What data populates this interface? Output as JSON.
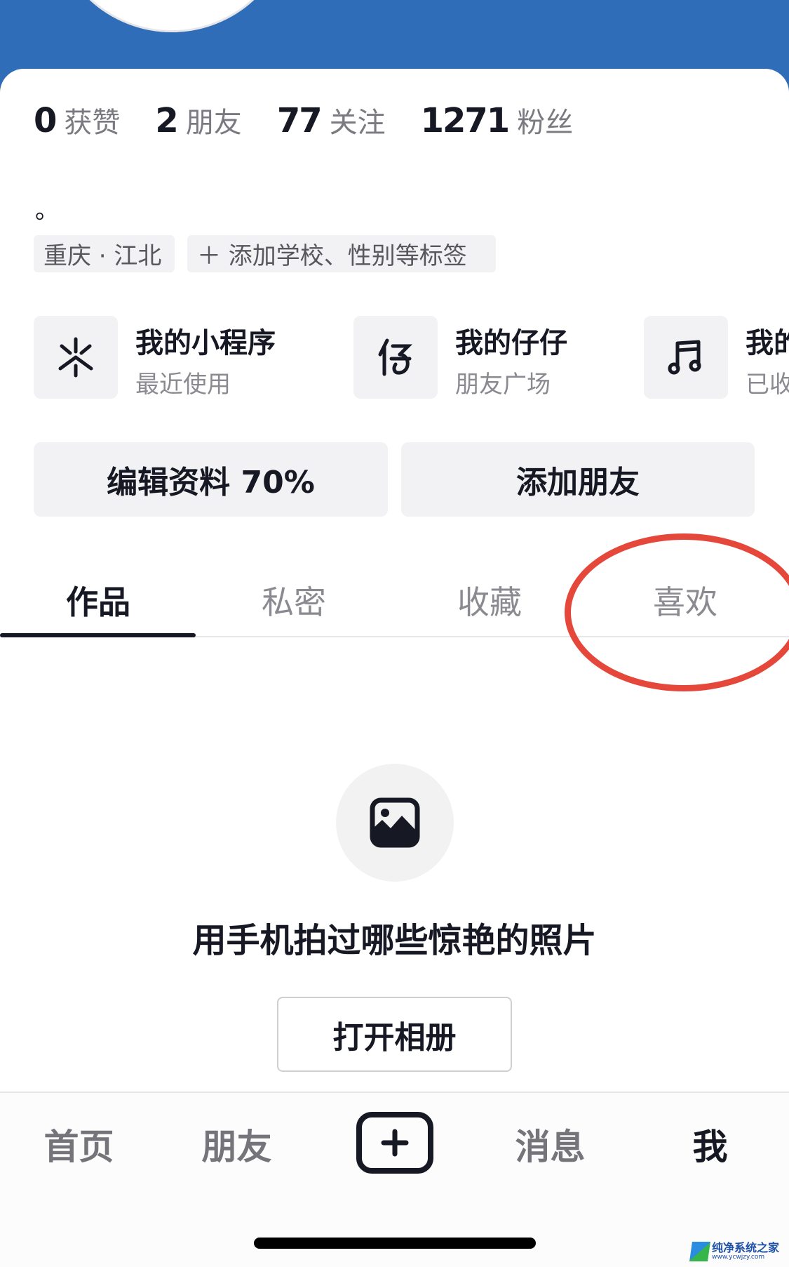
{
  "header": {
    "accent_color": "#2f6db8"
  },
  "stats": [
    {
      "value": "0",
      "label": "获赞"
    },
    {
      "value": "2",
      "label": "朋友"
    },
    {
      "value": "77",
      "label": "关注"
    },
    {
      "value": "1271",
      "label": "粉丝"
    }
  ],
  "bio": "。",
  "tags": {
    "location": "重庆 · 江北",
    "add_tags": "＋ 添加学校、性别等标签"
  },
  "shortcuts": [
    {
      "icon": "mini-program-icon",
      "title": "我的小程序",
      "subtitle": "最近使用"
    },
    {
      "icon": "zaizai-icon",
      "title": "我的仔仔",
      "subtitle": "朋友广场"
    },
    {
      "icon": "music-note-icon",
      "title": "我的",
      "subtitle": "已收"
    }
  ],
  "actions": {
    "edit_profile": "编辑资料 70%",
    "add_friend": "添加朋友"
  },
  "tabs": [
    {
      "label": "作品",
      "active": true
    },
    {
      "label": "私密",
      "active": false
    },
    {
      "label": "收藏",
      "active": false
    },
    {
      "label": "喜欢",
      "active": false
    }
  ],
  "annotation": {
    "target": "喜欢",
    "color": "#e5483b"
  },
  "empty_state": {
    "icon": "image-icon",
    "title": "用手机拍过哪些惊艳的照片",
    "button": "打开相册"
  },
  "bottom_nav": [
    {
      "label": "首页",
      "active": false
    },
    {
      "label": "朋友",
      "active": false
    },
    {
      "label": "",
      "icon": "plus-icon",
      "active": false
    },
    {
      "label": "消息",
      "active": false
    },
    {
      "label": "我",
      "active": true
    }
  ],
  "watermark": {
    "title": "纯净系统之家",
    "url": "www.ycwjzy.com"
  }
}
